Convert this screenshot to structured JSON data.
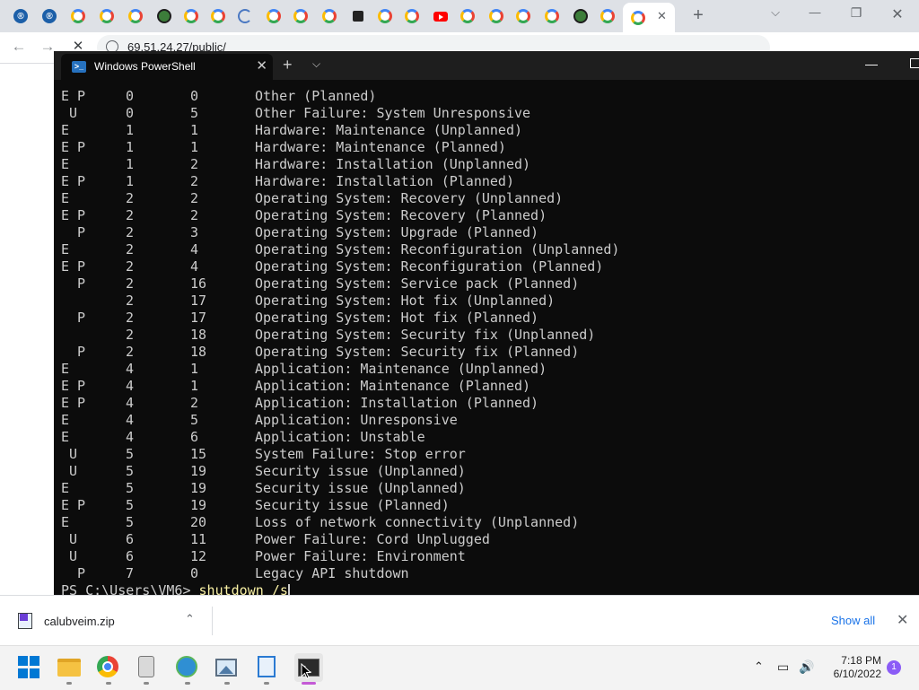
{
  "browser": {
    "address_url": "69.51.24.27/public/",
    "tab_favicons": [
      "reload-icon",
      "reload-icon",
      "google-icon",
      "google-icon",
      "google-icon",
      "xbox-icon",
      "google-icon",
      "google-icon",
      "loading-icon",
      "google-icon",
      "google-icon",
      "google-icon",
      "user-icon",
      "google-icon",
      "google-icon",
      "youtube-icon",
      "google-icon",
      "google-icon",
      "google-icon",
      "google-icon",
      "xbox-icon",
      "google-icon",
      "google-icon"
    ],
    "active_tab_close": "✕",
    "new_tab": "+",
    "win_min": "—",
    "win_restore": "❐",
    "win_close": "✕",
    "back": "←",
    "forward": "→",
    "stop": "✕"
  },
  "terminal": {
    "tab_title": "Windows PowerShell",
    "tab_close": "✕",
    "new_tab": "+",
    "dropdown": "⌵",
    "rows": [
      {
        "flags": "E P",
        "major": "0",
        "minor": "0",
        "reason": "Other (Planned)"
      },
      {
        "flags": " U",
        "major": "0",
        "minor": "5",
        "reason": "Other Failure: System Unresponsive"
      },
      {
        "flags": "E",
        "major": "1",
        "minor": "1",
        "reason": "Hardware: Maintenance (Unplanned)"
      },
      {
        "flags": "E P",
        "major": "1",
        "minor": "1",
        "reason": "Hardware: Maintenance (Planned)"
      },
      {
        "flags": "E",
        "major": "1",
        "minor": "2",
        "reason": "Hardware: Installation (Unplanned)"
      },
      {
        "flags": "E P",
        "major": "1",
        "minor": "2",
        "reason": "Hardware: Installation (Planned)"
      },
      {
        "flags": "E",
        "major": "2",
        "minor": "2",
        "reason": "Operating System: Recovery (Unplanned)"
      },
      {
        "flags": "E P",
        "major": "2",
        "minor": "2",
        "reason": "Operating System: Recovery (Planned)"
      },
      {
        "flags": "  P",
        "major": "2",
        "minor": "3",
        "reason": "Operating System: Upgrade (Planned)"
      },
      {
        "flags": "E",
        "major": "2",
        "minor": "4",
        "reason": "Operating System: Reconfiguration (Unplanned)"
      },
      {
        "flags": "E P",
        "major": "2",
        "minor": "4",
        "reason": "Operating System: Reconfiguration (Planned)"
      },
      {
        "flags": "  P",
        "major": "2",
        "minor": "16",
        "reason": "Operating System: Service pack (Planned)"
      },
      {
        "flags": "",
        "major": "2",
        "minor": "17",
        "reason": "Operating System: Hot fix (Unplanned)"
      },
      {
        "flags": "  P",
        "major": "2",
        "minor": "17",
        "reason": "Operating System: Hot fix (Planned)"
      },
      {
        "flags": "",
        "major": "2",
        "minor": "18",
        "reason": "Operating System: Security fix (Unplanned)"
      },
      {
        "flags": "  P",
        "major": "2",
        "minor": "18",
        "reason": "Operating System: Security fix (Planned)"
      },
      {
        "flags": "E",
        "major": "4",
        "minor": "1",
        "reason": "Application: Maintenance (Unplanned)"
      },
      {
        "flags": "E P",
        "major": "4",
        "minor": "1",
        "reason": "Application: Maintenance (Planned)"
      },
      {
        "flags": "E P",
        "major": "4",
        "minor": "2",
        "reason": "Application: Installation (Planned)"
      },
      {
        "flags": "E",
        "major": "4",
        "minor": "5",
        "reason": "Application: Unresponsive"
      },
      {
        "flags": "E",
        "major": "4",
        "minor": "6",
        "reason": "Application: Unstable"
      },
      {
        "flags": " U",
        "major": "5",
        "minor": "15",
        "reason": "System Failure: Stop error"
      },
      {
        "flags": " U",
        "major": "5",
        "minor": "19",
        "reason": "Security issue (Unplanned)"
      },
      {
        "flags": "E",
        "major": "5",
        "minor": "19",
        "reason": "Security issue (Unplanned)"
      },
      {
        "flags": "E P",
        "major": "5",
        "minor": "19",
        "reason": "Security issue (Planned)"
      },
      {
        "flags": "E",
        "major": "5",
        "minor": "20",
        "reason": "Loss of network connectivity (Unplanned)"
      },
      {
        "flags": " U",
        "major": "6",
        "minor": "11",
        "reason": "Power Failure: Cord Unplugged"
      },
      {
        "flags": " U",
        "major": "6",
        "minor": "12",
        "reason": "Power Failure: Environment"
      },
      {
        "flags": "  P",
        "major": "7",
        "minor": "0",
        "reason": "Legacy API shutdown"
      }
    ],
    "prompt": "PS C:\\Users\\VM6> ",
    "command": "shutdown /s"
  },
  "downloads": {
    "file_name": "calubveim.zip",
    "show_all": "Show all",
    "close": "✕",
    "chevron": "⌃"
  },
  "taskbar": {
    "apps": [
      "windows-start-icon",
      "file-explorer-icon",
      "chrome-icon",
      "jar-app-icon",
      "globe-app-icon",
      "photos-icon",
      "notepad-icon",
      "terminal-icon"
    ],
    "time": "7:18 PM",
    "date": "6/10/2022",
    "notification_count": "1",
    "tray_chevron": "⌃",
    "speaker": "🔊"
  }
}
